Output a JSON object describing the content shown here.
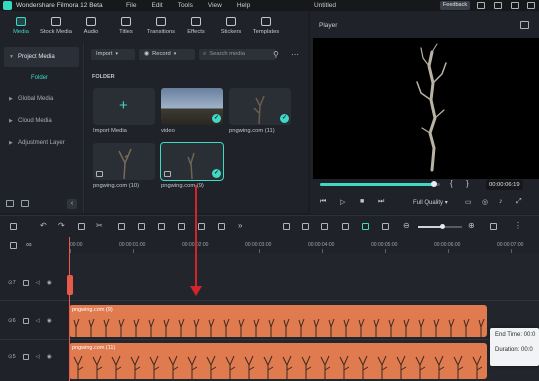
{
  "titlebar": {
    "app_title": "Wondershare Filmora 12 Beta",
    "menu": [
      "File",
      "Edit",
      "Tools",
      "View",
      "Help"
    ],
    "project_title": "Untitled",
    "feedback_label": "Feedback"
  },
  "media_tabs": [
    {
      "label": "Media",
      "icon": "film-icon",
      "active": true
    },
    {
      "label": "Stock Media",
      "icon": "stock-icon"
    },
    {
      "label": "Audio",
      "icon": "music-note-icon"
    },
    {
      "label": "Titles",
      "icon": "text-icon"
    },
    {
      "label": "Transitions",
      "icon": "transition-icon"
    },
    {
      "label": "Effects",
      "icon": "effects-icon"
    },
    {
      "label": "Stickers",
      "icon": "sticker-icon"
    },
    {
      "label": "Templates",
      "icon": "template-icon"
    }
  ],
  "sidebar": {
    "items": [
      {
        "label": "Project Media",
        "active": true
      },
      {
        "label": "Folder",
        "sub": true
      },
      {
        "label": "Global Media"
      },
      {
        "label": "Cloud Media"
      },
      {
        "label": "Adjustment Layer"
      }
    ]
  },
  "media": {
    "import_label": "Import",
    "record_label": "Record",
    "search_placeholder": "Search media",
    "folder_heading": "FOLDER",
    "items": [
      {
        "label": "Import Media",
        "type": "import"
      },
      {
        "label": "video",
        "type": "video",
        "checked": true
      },
      {
        "label": "pngwing.com (11)",
        "type": "image",
        "checked": true
      },
      {
        "label": "pngwing.com (10)",
        "type": "image"
      },
      {
        "label": "pngwing.com (9)",
        "type": "image",
        "checked": true,
        "selected": true
      }
    ]
  },
  "player": {
    "label": "Player",
    "timecode": "00:00:06:19",
    "quality": "Full Quality",
    "progress": 0.95
  },
  "timeline": {
    "ruler": [
      "00:00",
      "00:00:01:00",
      "00:00:02:00",
      "00:00:03:00",
      "00:00:04:00",
      "00:00:05:00",
      "00:00:06:00",
      "00:00:07:00"
    ],
    "tracks": [
      {
        "index": "7"
      },
      {
        "index": "6",
        "clip": "pngwing.com (9)"
      },
      {
        "index": "5",
        "clip": "pngwing.com (11)"
      }
    ],
    "zoom": 0.55
  },
  "tooltip": {
    "end_time": "End Time: 00:0",
    "duration": "Duration: 00:0"
  },
  "colors": {
    "accent": "#3fd9c6",
    "clip": "#e07a4f",
    "playhead": "#e85b4a",
    "arrow": "#d3242b"
  }
}
